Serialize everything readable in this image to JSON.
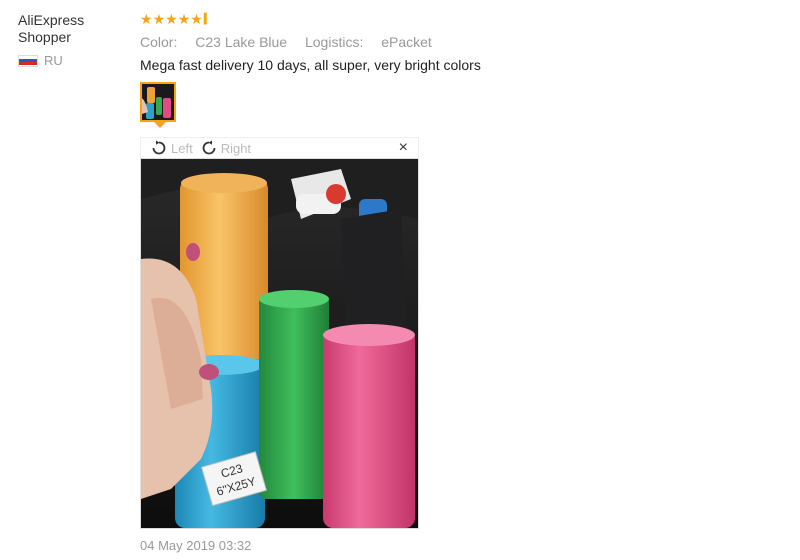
{
  "author": {
    "name": "AliExpress Shopper",
    "country": "RU"
  },
  "review": {
    "rating": 4.8,
    "attributes": [
      {
        "label": "Color:",
        "value": "C23 Lake Blue"
      },
      {
        "label": "Logistics:",
        "value": "ePacket"
      }
    ],
    "text": "Mega fast delivery 10 days, all super, very bright colors",
    "date": "04 May 2019 03:32"
  },
  "viewer": {
    "rotate_left": "Left",
    "rotate_right": "Right",
    "close_symbol": "×",
    "photo_label_line1": "C23",
    "photo_label_line2": "6\"X25Y"
  },
  "colors": {
    "accent": "#f7a314",
    "muted": "#999999",
    "text": "#222222"
  }
}
